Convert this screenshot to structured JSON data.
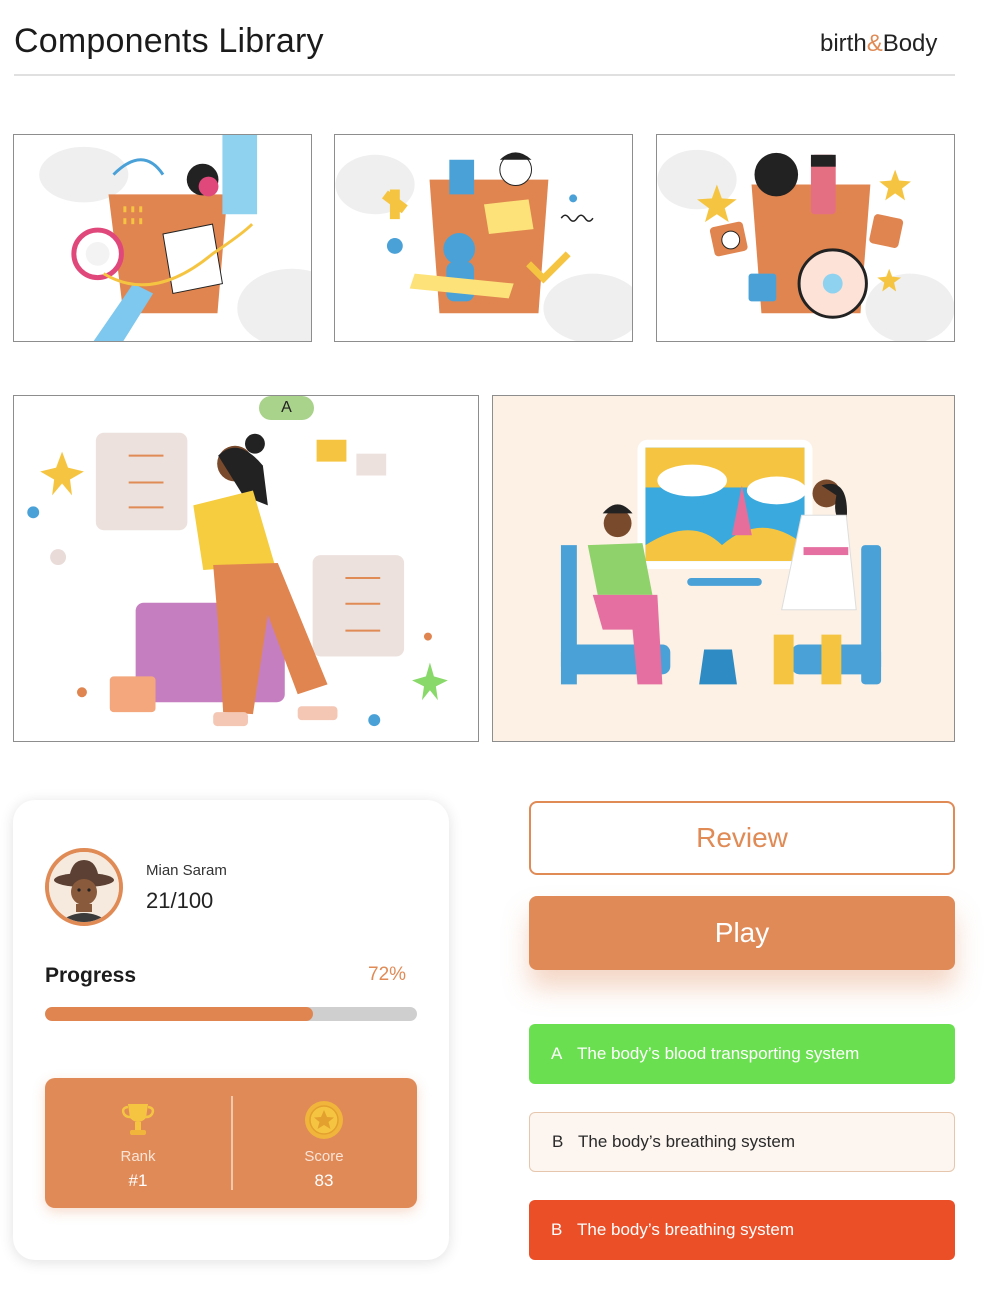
{
  "header": {
    "title": "Components Library",
    "logo_text_left": "birth",
    "logo_amp": "&",
    "logo_text_right": "Body"
  },
  "badge_label": "A",
  "profile": {
    "name": "Mian Saram",
    "score": "21/100",
    "progress_label": "Progress",
    "progress_percent_text": "72%",
    "progress_value": 0.72,
    "rank_label": "Rank",
    "rank_value": "#1",
    "score_label": "Score",
    "score_value": "83"
  },
  "buttons": {
    "review": "Review",
    "play": "Play"
  },
  "options": [
    {
      "letter": "A",
      "text": "The body’s blood transporting system",
      "state": "correct"
    },
    {
      "letter": "B",
      "text": "The body’s breathing system",
      "state": "neutral"
    },
    {
      "letter": "B",
      "text": "The body’s breathing system",
      "state": "wrong"
    }
  ],
  "colors": {
    "accent": "#e08a55",
    "correct": "#6ae050",
    "wrong": "#ea4f28"
  }
}
